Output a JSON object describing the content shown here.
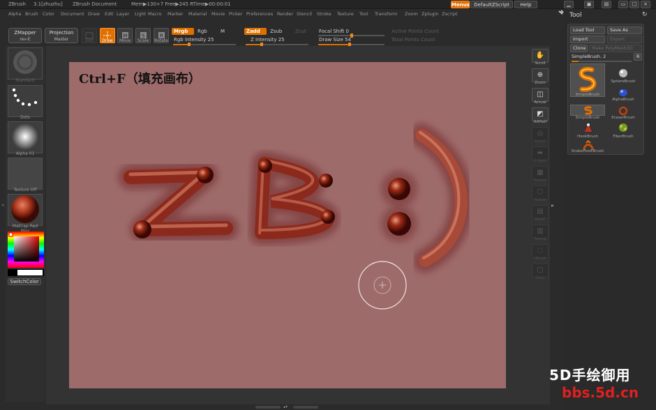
{
  "titlebar": {
    "app": "ZBrush",
    "version": "3.1[zhuzhu]",
    "doc": "ZBrush Document",
    "stats": "Mem▶130+7 Free▶245 RTime▶00:00:01",
    "menus_btn": "Menus",
    "script_btn": "DefaultZScript",
    "help_btn": "Help"
  },
  "menubar": [
    "Alpha",
    "Brush",
    "Color",
    "Document",
    "Draw",
    "Edit",
    "Layer",
    "Light",
    "Macro",
    "Marker",
    "Material",
    "Movie",
    "Picker",
    "Preferences",
    "Render",
    "Stencil",
    "Stroke",
    "Texture",
    "Tool",
    "Transform",
    "Zoom",
    "Zplugin",
    "Zscript"
  ],
  "shelf": {
    "zmapper": "ZMapper",
    "zmapper_sub": "rev-E",
    "projection": "Projection",
    "projection_sub": "Master",
    "tools": [
      {
        "label": "Edit",
        "active": false
      },
      {
        "label": "Draw",
        "active": true
      },
      {
        "label": "Move",
        "active": false
      },
      {
        "label": "Scale",
        "active": false
      },
      {
        "label": "Rotate",
        "active": false
      }
    ],
    "mrgb": "Mrgb",
    "rgb": "Rgb",
    "m": "M",
    "rgb_intensity": "Rgb Intensity 25",
    "zadd": "Zadd",
    "zsub": "Zsub",
    "zcut": "Zcut",
    "z_intensity": "Z Intensity 25",
    "focal_shift": "Focal Shift 0",
    "draw_size": "Draw Size 54",
    "active_points": "Active Points Count",
    "total_points": "Total Points Count",
    "rgb_intensity_value": 0.25,
    "z_intensity_value": 0.25,
    "focal_shift_value": 0.0,
    "draw_size_value": 0.54
  },
  "leftbar": {
    "items": [
      "Standard",
      "Dots",
      "Alpha 01",
      "Texture Off",
      "MatCap Red Wax"
    ],
    "switch_color": "SwitchColor"
  },
  "canvas": {
    "caption": "Ctrl+F（填充画布）",
    "background_color": "#9e6b6b",
    "painted_text": "ZB:)"
  },
  "rightbar": {
    "items": [
      {
        "label": "Scroll",
        "dim": false
      },
      {
        "label": "Zoom",
        "dim": false
      },
      {
        "label": "Actual",
        "dim": false
      },
      {
        "label": "AAHalf",
        "dim": false
      },
      {
        "label": "Local",
        "dim": true
      },
      {
        "label": "L.Sym",
        "dim": true
      },
      {
        "label": "Frame",
        "dim": true
      },
      {
        "label": "Xpose",
        "dim": true
      },
      {
        "label": "PolyF",
        "dim": true
      },
      {
        "label": "Transp",
        "dim": true
      },
      {
        "label": "Ghost",
        "dim": true
      },
      {
        "label": "Solo",
        "dim": true
      }
    ]
  },
  "toolpanel": {
    "title": "Tool",
    "load_tool": "Load Tool",
    "save_as": "Save As",
    "import": "Import",
    "export": "Export",
    "clone": "Clone",
    "make_polymesh": "Make PolyMesh3D",
    "current_brush": "SimpleBrush. 2",
    "r": "R",
    "brushes": [
      {
        "label": "SimpleBrush",
        "icon": "simplebrush-icon"
      },
      {
        "label": "SphereBrush",
        "icon": "spherebrush-icon"
      },
      {
        "label": "AlphaBrush",
        "icon": "alphabrush-icon"
      },
      {
        "label": "SimpleBrush",
        "icon": "simplebrush-icon"
      },
      {
        "label": "EraserBrush",
        "icon": "eraserbrush-icon"
      },
      {
        "label": "HookBrush",
        "icon": "hookbrush-icon"
      },
      {
        "label": "FiberBrush",
        "icon": "fiberbrush-icon"
      },
      {
        "label": "SnakeHookBrush",
        "icon": "snakehookbrush-icon"
      }
    ]
  },
  "watermark": {
    "line1": "5D手绘御用",
    "line2": "bbs.5d.cn"
  },
  "colors": {
    "accent": "#e07000",
    "canvas": "#9e6b6b",
    "ui_dark": "#2b2b2b"
  }
}
